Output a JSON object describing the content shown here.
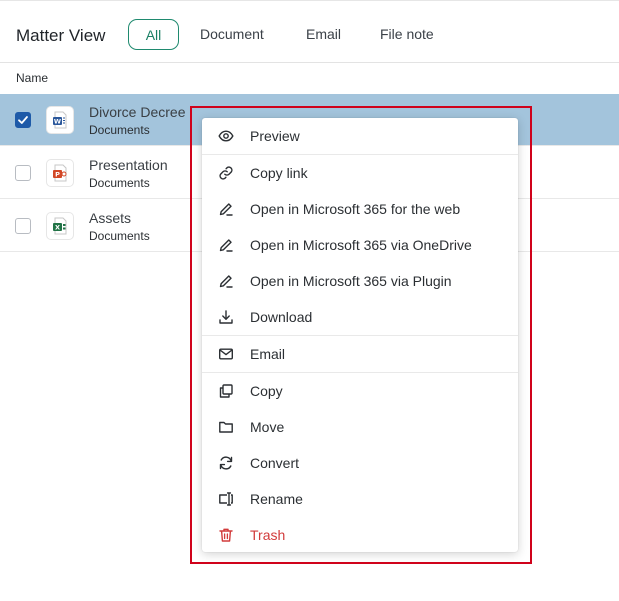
{
  "header": {
    "title": "Matter View",
    "tabs": [
      {
        "label": "All",
        "active": true
      },
      {
        "label": "Document",
        "active": false
      },
      {
        "label": "Email",
        "active": false
      },
      {
        "label": "File note",
        "active": false
      }
    ]
  },
  "table": {
    "column_name": "Name",
    "rows": [
      {
        "name": "Divorce Decree",
        "sub": "Documents",
        "icon": "word-file-icon",
        "checked": true
      },
      {
        "name": "Presentation",
        "sub": "Documents",
        "icon": "powerpoint-file-icon",
        "checked": false
      },
      {
        "name": "Assets",
        "sub": "Documents",
        "icon": "excel-file-icon",
        "checked": false
      }
    ]
  },
  "menu": {
    "items": [
      {
        "label": "Preview",
        "icon": "eye-icon"
      },
      {
        "label": "Copy link",
        "icon": "link-icon"
      },
      {
        "label": "Open in Microsoft 365 for the web",
        "icon": "pencil-icon"
      },
      {
        "label": "Open in Microsoft 365 via OneDrive",
        "icon": "pencil-icon"
      },
      {
        "label": "Open in Microsoft 365 via Plugin",
        "icon": "pencil-icon"
      },
      {
        "label": "Download",
        "icon": "download-icon"
      },
      {
        "label": "Email",
        "icon": "mail-icon"
      },
      {
        "label": "Copy",
        "icon": "copy-icon"
      },
      {
        "label": "Move",
        "icon": "folder-icon"
      },
      {
        "label": "Convert",
        "icon": "refresh-icon"
      },
      {
        "label": "Rename",
        "icon": "rename-icon"
      },
      {
        "label": "Trash",
        "icon": "trash-icon",
        "danger": true
      }
    ]
  },
  "colors": {
    "accent": "#1a7f64",
    "selected_row": "#a3c4dc",
    "checkbox": "#1e5aa8",
    "danger": "#d23b3b",
    "highlight_box": "#d0021b"
  }
}
